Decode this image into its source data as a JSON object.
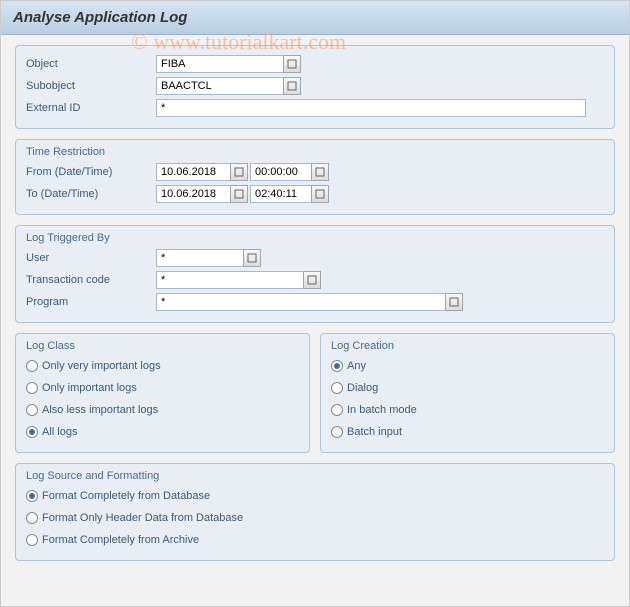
{
  "header": {
    "title": "Analyse Application Log"
  },
  "watermark": "© www.tutorialkart.com",
  "top": {
    "object_label": "Object",
    "object_value": "FIBA",
    "subobject_label": "Subobject",
    "subobject_value": "BAACTCL",
    "external_id_label": "External ID",
    "external_id_value": "*"
  },
  "time": {
    "title": "Time Restriction",
    "from_label": "From (Date/Time)",
    "from_date": "10.06.2018",
    "from_time": "00:00:00",
    "to_label": "To (Date/Time)",
    "to_date": "10.06.2018",
    "to_time": "02:40:11"
  },
  "trigger": {
    "title": "Log Triggered By",
    "user_label": "User",
    "user_value": "*",
    "tcode_label": "Transaction code",
    "tcode_value": "*",
    "program_label": "Program",
    "program_value": "*"
  },
  "log_class": {
    "title": "Log Class",
    "options": [
      "Only very important logs",
      "Only important logs",
      "Also less important logs",
      "All logs"
    ],
    "selected": 3
  },
  "log_creation": {
    "title": "Log Creation",
    "options": [
      "Any",
      "Dialog",
      "In batch mode",
      "Batch input"
    ],
    "selected": 0
  },
  "source": {
    "title": "Log Source and Formatting",
    "options": [
      "Format Completely from Database",
      "Format Only Header Data from Database",
      "Format Completely from Archive"
    ],
    "selected": 0
  }
}
